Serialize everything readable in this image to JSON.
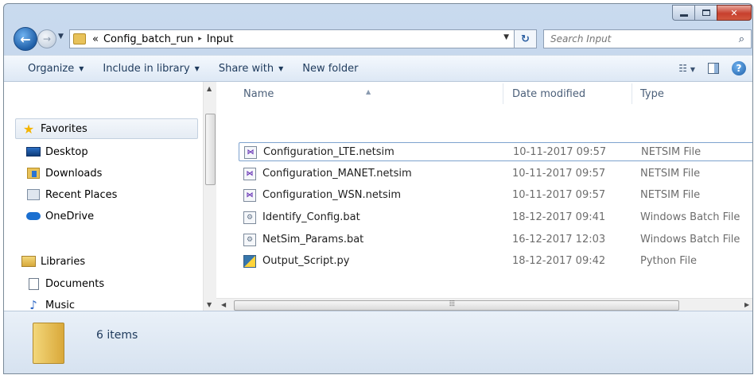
{
  "address": {
    "prefix": "«",
    "crumbs": [
      "Config_batch_run",
      "Input"
    ],
    "separator": "▸"
  },
  "search": {
    "placeholder": "Search Input"
  },
  "toolbar": {
    "organize": "Organize",
    "include": "Include in library",
    "share": "Share with",
    "new_folder": "New folder"
  },
  "nav": {
    "favorites": "Favorites",
    "desktop": "Desktop",
    "downloads": "Downloads",
    "recent": "Recent Places",
    "onedrive": "OneDrive",
    "libraries": "Libraries",
    "documents": "Documents",
    "music": "Music"
  },
  "columns": {
    "name": "Name",
    "date": "Date modified",
    "type": "Type"
  },
  "files": [
    {
      "name": "Configuration_LTE.netsim",
      "date": "10-11-2017 09:57",
      "type": "NETSIM File"
    },
    {
      "name": "Configuration_MANET.netsim",
      "date": "10-11-2017 09:57",
      "type": "NETSIM File"
    },
    {
      "name": "Configuration_WSN.netsim",
      "date": "10-11-2017 09:57",
      "type": "NETSIM File"
    },
    {
      "name": "Identify_Config.bat",
      "date": "18-12-2017 09:41",
      "type": "Windows Batch File"
    },
    {
      "name": "NetSim_Params.bat",
      "date": "16-12-2017 12:03",
      "type": "Windows Batch File"
    },
    {
      "name": "Output_Script.py",
      "date": "18-12-2017 09:42",
      "type": "Python File"
    }
  ],
  "details": {
    "count": "6 items"
  }
}
